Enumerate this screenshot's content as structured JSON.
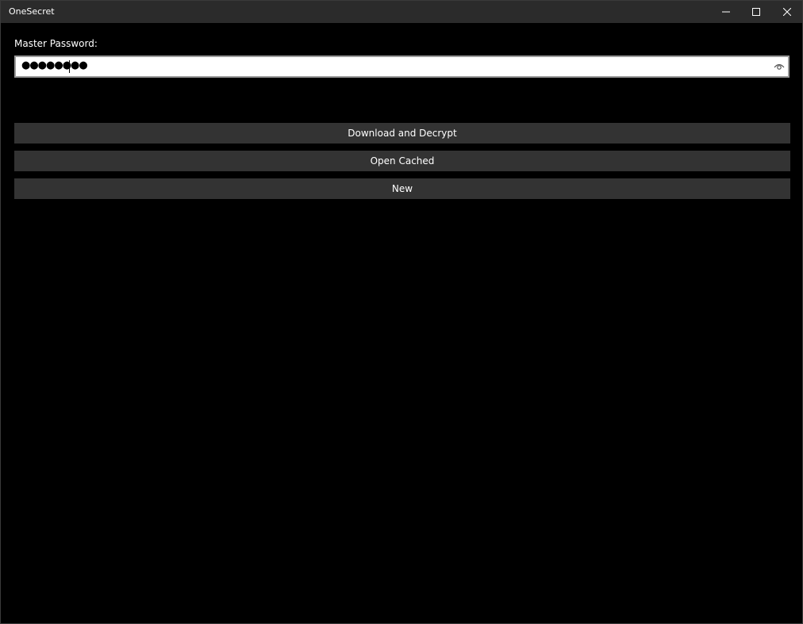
{
  "window": {
    "title": "OneSecret"
  },
  "caption": {
    "minimize_icon": "minimize-icon",
    "maximize_icon": "maximize-icon",
    "close_icon": "close-icon"
  },
  "form": {
    "password_label": "Master Password:",
    "password_value": "●●●●●●●●",
    "reveal_icon": "eye-icon"
  },
  "actions": {
    "download_label": "Download and Decrypt",
    "open_cached_label": "Open Cached",
    "new_label": "New"
  },
  "colors": {
    "background": "#000000",
    "titlebar": "#2b2b2b",
    "button": "#333333",
    "text": "#ffffff"
  }
}
